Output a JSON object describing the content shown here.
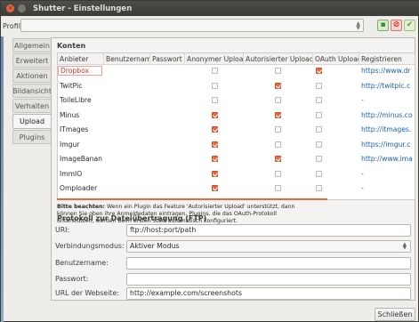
{
  "window": {
    "title": "Shutter - Einstellungen"
  },
  "profile": {
    "label": "Profil:",
    "value": ""
  },
  "toolbar_buttons": [
    {
      "icon": "save-profile-icon",
      "glyph": "▪",
      "color": "#3b8a2f"
    },
    {
      "icon": "delete-profile-icon",
      "glyph": "⊘",
      "color": "#cc2a1a"
    },
    {
      "icon": "apply-profile-icon",
      "glyph": "✔",
      "color": "#5aa02c"
    }
  ],
  "tabs": [
    "Allgemein",
    "Erweitert",
    "Aktionen",
    "Bildansicht",
    "Verhalten",
    "Upload",
    "Plugins"
  ],
  "active_tab": "Upload",
  "accounts": {
    "title": "Konten",
    "columns": [
      "Anbieter",
      "Benutzername",
      "Passwort",
      "Anonymer Upload",
      "Autorisierter Upload",
      "OAuth Upload",
      "Registrieren"
    ],
    "rows": [
      {
        "provider": "Dropbox",
        "user": "",
        "pass": "",
        "anon": false,
        "auth": false,
        "oauth": true,
        "register": "https://www.dr"
      },
      {
        "provider": "TwitPic",
        "user": "",
        "pass": "",
        "anon": false,
        "auth": true,
        "oauth": false,
        "register": "http://twitpic.c"
      },
      {
        "provider": "ToileLibre",
        "user": "",
        "pass": "",
        "anon": false,
        "auth": false,
        "oauth": false,
        "register": "-"
      },
      {
        "provider": "Minus",
        "user": "",
        "pass": "",
        "anon": true,
        "auth": true,
        "oauth": false,
        "register": "http://minus.co"
      },
      {
        "provider": "ITmages",
        "user": "",
        "pass": "",
        "anon": true,
        "auth": false,
        "oauth": false,
        "register": "http://itmages."
      },
      {
        "provider": "Imgur",
        "user": "",
        "pass": "",
        "anon": true,
        "auth": false,
        "oauth": false,
        "register": "https://imgur.c"
      },
      {
        "provider": "ImageBanana",
        "user": "",
        "pass": "",
        "anon": true,
        "auth": true,
        "oauth": false,
        "register": "http://www.ima"
      },
      {
        "provider": "ImmIO",
        "user": "",
        "pass": "",
        "anon": true,
        "auth": false,
        "oauth": false,
        "register": "-"
      },
      {
        "provider": "Omploader",
        "user": "",
        "pass": "",
        "anon": true,
        "auth": false,
        "oauth": false,
        "register": "-"
      }
    ]
  },
  "note": {
    "bold": "Bitte beachten:",
    "text": " Wenn ein Plugin das Feature 'Autorisierter Upload' unterstützt, dann können Sie oben ihre Anmeldedaten eintragen. Plugins, die das OAuth-Protokoll unterstützen, werden beim ersten Start automatisch konfiguriert."
  },
  "ftp": {
    "title": "Protokoll zur Dateiübertragung (FTP)",
    "uri_label": "URI:",
    "uri_value": "ftp://host:port/path",
    "mode_label": "Verbindungsmodus:",
    "mode_value": "Aktiver Modus",
    "user_label": "Benutzername:",
    "user_value": "",
    "pass_label": "Passwort:",
    "pass_value": "",
    "url_label": "URL der Webseite:",
    "url_value": "http://example.com/screenshots"
  },
  "close_button": "Schließen"
}
